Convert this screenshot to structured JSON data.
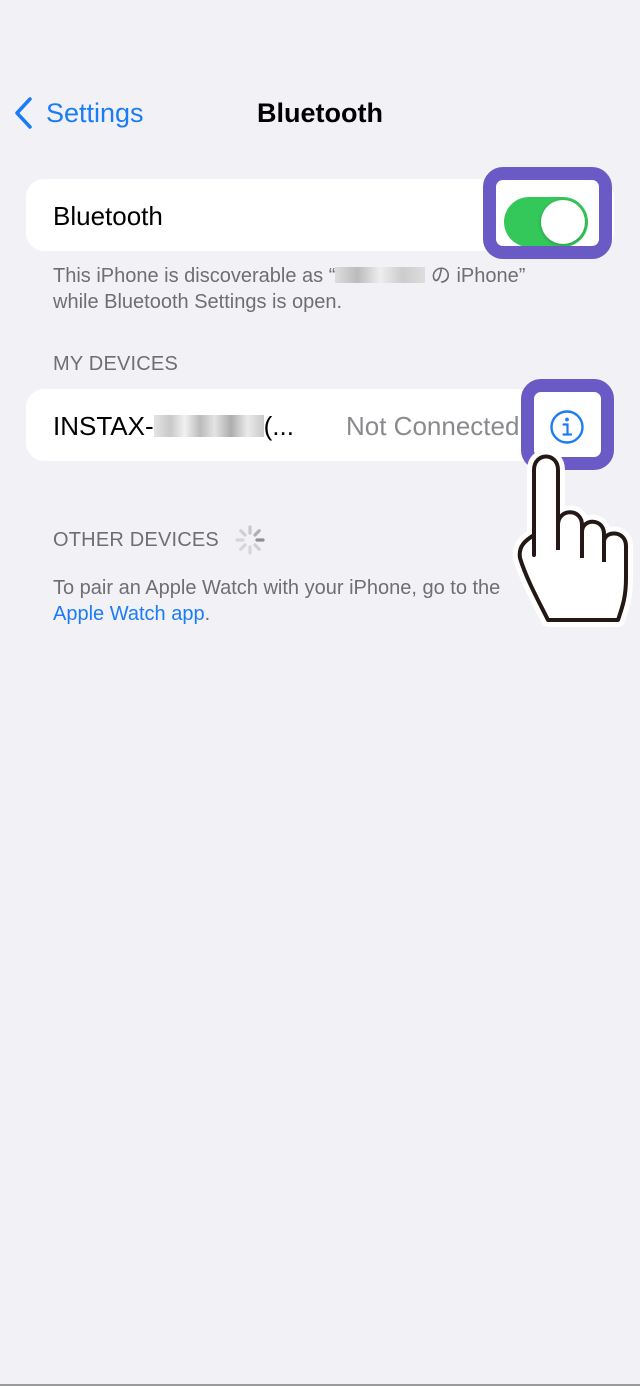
{
  "navbar": {
    "back_label": "Settings",
    "title": "Bluetooth"
  },
  "bluetooth": {
    "label": "Bluetooth",
    "enabled": true,
    "toggle_color": "#34c759",
    "discoverable_prefix": "This iPhone is discoverable as “",
    "discoverable_suffix": " の iPhone”",
    "discoverable_line2": "while Bluetooth Settings is open."
  },
  "my_devices": {
    "header": "MY DEVICES",
    "items": [
      {
        "name_prefix": "INSTAX-",
        "name_suffix": "(...",
        "status": "Not Connected",
        "info_icon": "info-circle-icon"
      }
    ]
  },
  "other_devices": {
    "header": "OTHER DEVICES",
    "loading": true,
    "pair_text": "To pair an Apple Watch with your iPhone, go to the",
    "pair_link": "Apple Watch app",
    "pair_end": "."
  },
  "colors": {
    "accent": "#1a7cf6",
    "highlight": "#6a5ac6",
    "background": "#f2f1f6"
  }
}
